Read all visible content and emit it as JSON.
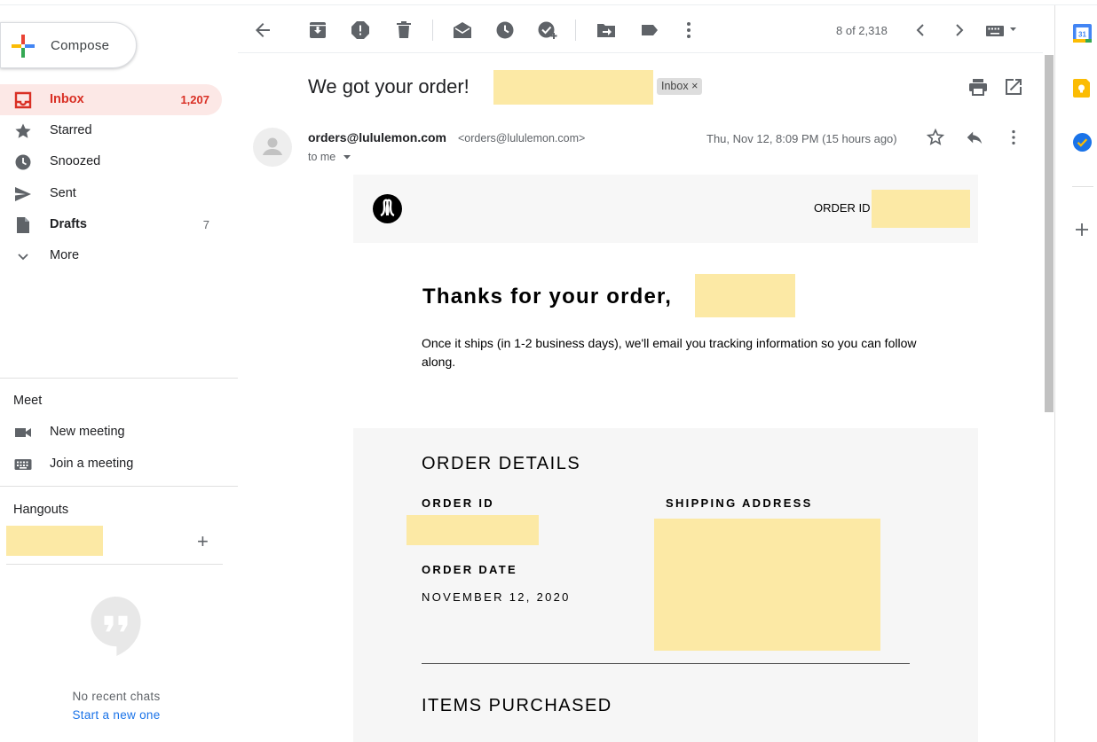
{
  "nav": {
    "compose": "Compose",
    "items": [
      {
        "label": "Inbox",
        "count": "1,207"
      },
      {
        "label": "Starred",
        "count": ""
      },
      {
        "label": "Snoozed",
        "count": ""
      },
      {
        "label": "Sent",
        "count": ""
      },
      {
        "label": "Drafts",
        "count": "7"
      },
      {
        "label": "More",
        "count": ""
      }
    ]
  },
  "meet": {
    "title": "Meet",
    "new_meeting": "New meeting",
    "join_meeting": "Join a meeting"
  },
  "hangouts": {
    "title": "Hangouts",
    "no_recent": "No recent chats",
    "start_new": "Start a new one"
  },
  "toolbar": {
    "pager": "8 of 2,318",
    "icons": [
      "back-arrow-icon",
      "archive-icon",
      "report-spam-icon",
      "delete-icon",
      "mark-unread-icon",
      "snooze-icon",
      "add-task-icon",
      "move-to-icon",
      "label-icon",
      "more-vert-icon",
      "chevron-left-icon",
      "chevron-right-icon",
      "keyboard-icon"
    ]
  },
  "message": {
    "subject": "We got your order!",
    "label_chip": "Inbox",
    "label_chip_close": "×",
    "sender_name": "orders@lululemon.com",
    "sender_email": "<orders@lululemon.com>",
    "to": "to me",
    "date": "Thu, Nov 12, 8:09 PM (15 hours ago)"
  },
  "email": {
    "order_id_header": "ORDER ID",
    "thanks": "Thanks for your order,",
    "ship_message": "Once it ships (in 1-2 business days), we'll email you tracking information so you can follow along.",
    "order_details_title": "ORDER DETAILS",
    "order_id_label": "ORDER ID",
    "shipping_address_label": "SHIPPING ADDRESS",
    "order_date_label": "ORDER DATE",
    "order_date_value": "NOVEMBER 12, 2020",
    "items_purchased_title": "ITEMS PURCHASED"
  },
  "colors": {
    "accent_red": "#d93025",
    "redaction": "#fce9a5",
    "link_blue": "#1a73e8"
  }
}
